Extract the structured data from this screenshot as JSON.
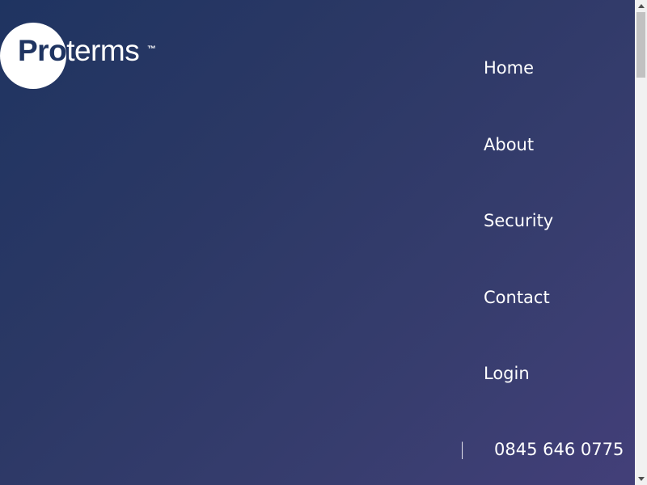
{
  "brand": {
    "logo_pro": "Pro",
    "logo_terms": "terms",
    "logo_tm": "™"
  },
  "nav": {
    "items": [
      {
        "label": "Home"
      },
      {
        "label": "About"
      },
      {
        "label": "Security"
      },
      {
        "label": "Contact"
      },
      {
        "label": "Login"
      }
    ],
    "separator": "|",
    "phone": "0845 646 0775"
  },
  "colors": {
    "background_start": "#1f3461",
    "background_end": "#433f79",
    "logo_circle": "#ffffff",
    "nav_text": "#ffffff"
  },
  "icons": {
    "scroll_up": "scroll-up-arrow-icon",
    "scroll_down": "scroll-down-arrow-icon"
  }
}
